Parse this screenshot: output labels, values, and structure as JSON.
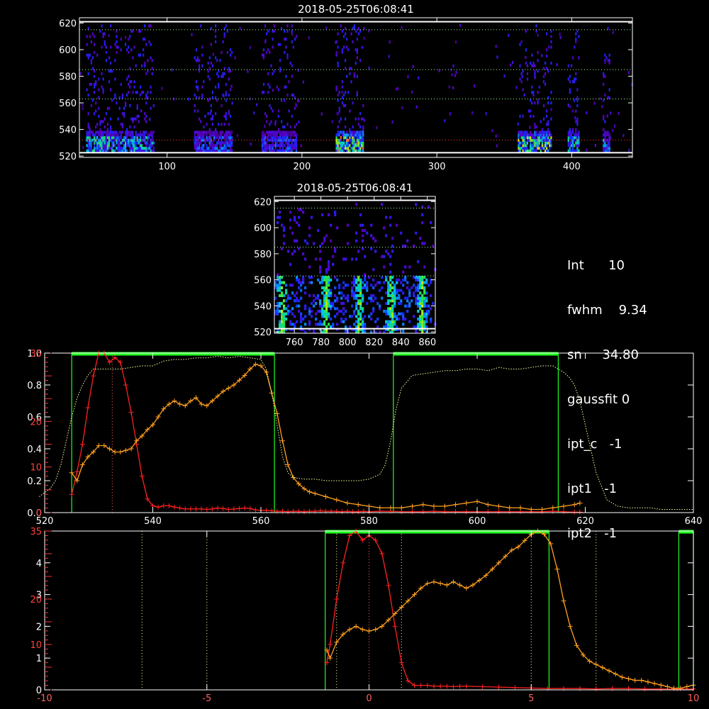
{
  "top_panel": {
    "title": "2018-05-25T06:08:41",
    "xlim": [
      35,
      445
    ],
    "ylim": [
      519,
      624
    ],
    "x_ticks": [
      100,
      200,
      300,
      400
    ],
    "y_ticks": [
      520,
      540,
      560,
      580,
      600,
      620
    ],
    "guide_lines_y": [
      532,
      563,
      585,
      615
    ],
    "hot_columns": [
      {
        "x0": 40,
        "x1": 62,
        "peak": 0.75
      },
      {
        "x0": 62,
        "x1": 90,
        "peak": 0.7
      },
      {
        "x0": 120,
        "x1": 148,
        "peak": 0.55
      },
      {
        "x0": 170,
        "x1": 196,
        "peak": 0.55
      },
      {
        "x0": 225,
        "x1": 245,
        "peak": 1.0
      },
      {
        "x0": 360,
        "x1": 385,
        "peak": 0.9
      },
      {
        "x0": 397,
        "x1": 405,
        "peak": 0.75
      },
      {
        "x0": 423,
        "x1": 428,
        "peak": 0.6
      }
    ]
  },
  "mid_panel": {
    "title": "2018-05-25T06:08:41",
    "xlim": [
      745,
      866
    ],
    "ylim": [
      519,
      624
    ],
    "x_ticks": [
      760,
      780,
      800,
      820,
      840,
      860
    ],
    "y_ticks": [
      520,
      540,
      560,
      580,
      600,
      620
    ],
    "guide_lines_y": [
      563,
      585,
      615
    ],
    "streaks_x": [
      750,
      783,
      808,
      832,
      855
    ]
  },
  "info": {
    "lines": [
      "Int      10",
      "fwhm    9.34",
      "sn     34.80",
      "gaussfit 0",
      "ipt_c   -1",
      "ipt1   -1",
      "ipt2   -1"
    ]
  },
  "chart_data": [
    {
      "type": "line",
      "xlim": [
        520,
        640
      ],
      "x_ticks": [
        520,
        540,
        560,
        580,
        600,
        620,
        640
      ],
      "y_left_white": {
        "range": [
          0,
          1
        ],
        "ticks": [
          "0.0",
          "0.2",
          "0.4",
          "0.6",
          "0.8",
          "1.0"
        ]
      },
      "y_left_red": {
        "range": [
          0,
          35
        ],
        "ticks": [
          "0",
          "10",
          "20",
          "35"
        ]
      },
      "green_windows": [
        [
          525,
          562.5
        ],
        [
          584.5,
          615
        ]
      ],
      "dotted_lines_x": [
        532.5
      ],
      "series": [
        {
          "color": "#ff2020",
          "x": [
            525,
            526,
            527,
            528,
            529,
            530,
            531,
            532,
            533,
            534,
            535,
            536,
            537,
            538,
            539,
            540,
            541,
            542,
            543,
            544,
            545,
            546,
            547,
            548,
            549,
            550,
            551,
            552,
            553,
            554,
            555,
            556,
            557,
            558,
            559,
            560,
            561,
            562,
            563,
            564,
            565,
            566,
            567,
            568,
            569,
            570,
            571,
            572,
            573,
            574,
            575,
            576,
            577,
            578,
            579,
            580,
            582,
            584,
            586,
            588,
            590,
            592,
            594,
            596,
            598,
            600,
            602,
            604,
            606,
            608,
            610,
            612,
            614,
            616,
            618,
            619
          ],
          "y": [
            4,
            9,
            15,
            23,
            30,
            35,
            36,
            33,
            34,
            33,
            28,
            22,
            15,
            8,
            3,
            1.5,
            1.2,
            1.5,
            1.5,
            1.2,
            1.0,
            0.8,
            0.8,
            0.8,
            0.8,
            0.7,
            0.8,
            1,
            0.9,
            0.7,
            0.8,
            0.9,
            1.0,
            0.9,
            0.6,
            0.5,
            0.5,
            0.4,
            0.3,
            0.3,
            0.2,
            0.3,
            0.3,
            0.2,
            0.3,
            0.3,
            0.4,
            0.3,
            0.3,
            0.3,
            0.2,
            0.3,
            0.2,
            0.2,
            0.3,
            0.2,
            0.3,
            0.3,
            0.2,
            0.2,
            0.2,
            0.3,
            0.2,
            0.2,
            0.2,
            0.2,
            0.2,
            0.2,
            0.2,
            0.2,
            0.2,
            0.2,
            0.3,
            0.2,
            0.1,
            0.1
          ]
        },
        {
          "color": "#ffa020",
          "x": [
            525,
            526,
            527,
            528,
            529,
            530,
            531,
            532,
            533,
            534,
            535,
            536,
            537,
            538,
            539,
            540,
            541,
            542,
            543,
            544,
            545,
            546,
            547,
            548,
            549,
            550,
            551,
            552,
            553,
            554,
            555,
            556,
            557,
            558,
            559,
            560,
            561,
            562,
            563,
            564,
            565,
            566,
            567,
            568,
            569,
            570,
            572,
            574,
            576,
            578,
            580,
            582,
            584,
            586,
            588,
            590,
            592,
            594,
            596,
            598,
            600,
            602,
            604,
            606,
            608,
            610,
            612,
            614,
            616,
            618,
            619
          ],
          "y": [
            0.25,
            0.2,
            0.3,
            0.35,
            0.38,
            0.42,
            0.42,
            0.4,
            0.38,
            0.38,
            0.39,
            0.4,
            0.45,
            0.48,
            0.52,
            0.55,
            0.6,
            0.65,
            0.68,
            0.7,
            0.68,
            0.67,
            0.7,
            0.72,
            0.68,
            0.67,
            0.7,
            0.73,
            0.76,
            0.78,
            0.8,
            0.83,
            0.86,
            0.9,
            0.93,
            0.92,
            0.88,
            0.75,
            0.62,
            0.45,
            0.3,
            0.22,
            0.18,
            0.15,
            0.13,
            0.12,
            0.1,
            0.08,
            0.06,
            0.05,
            0.04,
            0.03,
            0.03,
            0.03,
            0.04,
            0.05,
            0.04,
            0.04,
            0.05,
            0.06,
            0.07,
            0.05,
            0.04,
            0.03,
            0.03,
            0.02,
            0.02,
            0.03,
            0.04,
            0.05,
            0.06
          ]
        },
        {
          "color": "#ffffa0",
          "dotted": true,
          "x": [
            519,
            521,
            522,
            523,
            524,
            525,
            526,
            527,
            528,
            529,
            530,
            531,
            532,
            534,
            536,
            538,
            540,
            542,
            544,
            546,
            548,
            550,
            552,
            554,
            556,
            558,
            560,
            561,
            562,
            563,
            564,
            565,
            566,
            568,
            570,
            572,
            574,
            576,
            578,
            580,
            582,
            583,
            584,
            585,
            586,
            588,
            590,
            592,
            594,
            596,
            598,
            600,
            602,
            604,
            606,
            608,
            610,
            612,
            614,
            615,
            616,
            617,
            618,
            619,
            620,
            621,
            622,
            624,
            626,
            628,
            630,
            632,
            634,
            636,
            638,
            640
          ],
          "y": [
            0.1,
            0.15,
            0.2,
            0.3,
            0.45,
            0.6,
            0.72,
            0.8,
            0.86,
            0.9,
            0.9,
            0.9,
            0.9,
            0.9,
            0.91,
            0.92,
            0.92,
            0.95,
            0.96,
            0.96,
            0.97,
            0.97,
            0.98,
            0.97,
            0.98,
            0.97,
            0.96,
            0.9,
            0.75,
            0.55,
            0.35,
            0.25,
            0.22,
            0.21,
            0.21,
            0.2,
            0.2,
            0.2,
            0.2,
            0.21,
            0.24,
            0.3,
            0.45,
            0.65,
            0.78,
            0.86,
            0.87,
            0.88,
            0.89,
            0.89,
            0.9,
            0.9,
            0.89,
            0.91,
            0.9,
            0.9,
            0.91,
            0.92,
            0.92,
            0.9,
            0.88,
            0.85,
            0.8,
            0.7,
            0.55,
            0.4,
            0.25,
            0.08,
            0.04,
            0.03,
            0.03,
            0.03,
            0.02,
            0.02,
            0.02,
            0.02
          ]
        }
      ]
    },
    {
      "type": "line",
      "xlim": [
        -10,
        10
      ],
      "x_ticks": [
        -10,
        -5,
        0,
        5,
        10
      ],
      "y_left_white": {
        "range": [
          0,
          5
        ],
        "ticks": [
          "0",
          "1",
          "2",
          "3",
          "4"
        ]
      },
      "y_left_red": {
        "range": [
          0,
          35
        ],
        "ticks": [
          "10",
          "20",
          "35"
        ]
      },
      "green_windows": [
        [
          -1.35,
          5.55
        ],
        [
          9.55,
          10
        ]
      ],
      "dotted_lines_x": [
        -7,
        -5,
        -1,
        0,
        1,
        5,
        7
      ],
      "series": [
        {
          "color": "#ff2020",
          "x": [
            -1.3,
            -1.2,
            -1.0,
            -0.8,
            -0.6,
            -0.4,
            -0.2,
            0,
            0.2,
            0.4,
            0.6,
            0.8,
            1.0,
            1.2,
            1.4,
            1.6,
            1.8,
            2.0,
            2.2,
            2.4,
            2.6,
            2.8,
            3.0,
            3.5,
            4,
            4.5,
            5,
            5.5,
            6,
            6.5,
            7,
            7.5,
            8,
            8.5,
            9,
            9.5,
            10
          ],
          "y": [
            6,
            10,
            20,
            28,
            34,
            36,
            33,
            34,
            33,
            30,
            23,
            14,
            6,
            2,
            1,
            1,
            1,
            0.8,
            0.8,
            0.8,
            0.7,
            0.8,
            0.8,
            0.7,
            0.6,
            0.5,
            0.4,
            0.3,
            0.3,
            0.3,
            0.2,
            0.3,
            0.3,
            0.2,
            0.2,
            0.2,
            0.2
          ]
        },
        {
          "color": "#ffa020",
          "x": [
            -1.3,
            -1.2,
            -1.0,
            -0.8,
            -0.6,
            -0.4,
            -0.2,
            0,
            0.2,
            0.4,
            0.6,
            0.8,
            1.0,
            1.2,
            1.4,
            1.6,
            1.8,
            2.0,
            2.2,
            2.4,
            2.6,
            2.8,
            3.0,
            3.2,
            3.4,
            3.6,
            3.8,
            4.0,
            4.2,
            4.4,
            4.6,
            4.8,
            5.0,
            5.2,
            5.4,
            5.6,
            5.8,
            6.0,
            6.2,
            6.4,
            6.6,
            6.8,
            7.0,
            7.2,
            7.4,
            7.6,
            7.8,
            8.0,
            8.2,
            8.4,
            8.6,
            8.8,
            9.0,
            9.2,
            9.4,
            9.6,
            9.8,
            10
          ],
          "y": [
            1.25,
            1.0,
            1.5,
            1.75,
            1.9,
            2.0,
            1.9,
            1.85,
            1.9,
            2.0,
            2.2,
            2.4,
            2.6,
            2.8,
            3.0,
            3.2,
            3.35,
            3.4,
            3.35,
            3.3,
            3.4,
            3.3,
            3.2,
            3.3,
            3.45,
            3.6,
            3.8,
            4.0,
            4.2,
            4.4,
            4.5,
            4.7,
            4.9,
            5.0,
            4.9,
            4.6,
            3.8,
            2.8,
            2.0,
            1.4,
            1.1,
            0.9,
            0.8,
            0.7,
            0.6,
            0.5,
            0.4,
            0.35,
            0.3,
            0.3,
            0.25,
            0.2,
            0.15,
            0.1,
            0.05,
            0.05,
            0.1,
            0.15
          ]
        }
      ]
    }
  ]
}
